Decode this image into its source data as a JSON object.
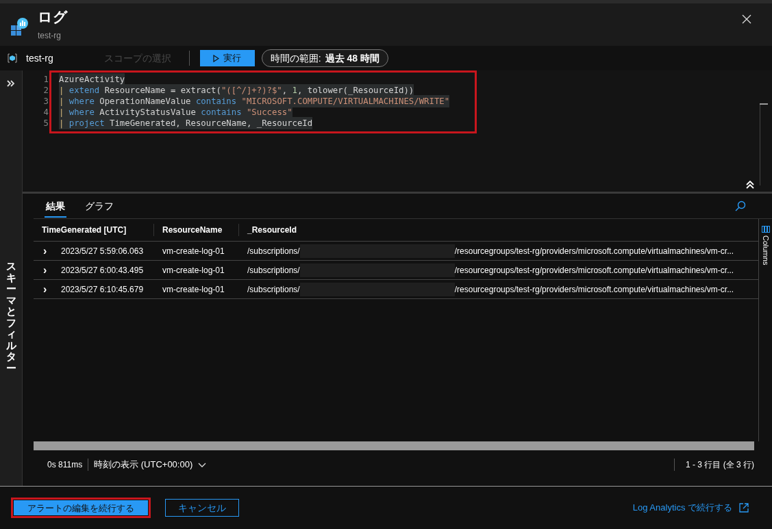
{
  "header": {
    "title": "ログ",
    "subtitle": "test-rg"
  },
  "toolbar": {
    "scope": "test-rg",
    "scope_select": {
      "label": "スコープの選択",
      "disabled": true
    },
    "run_button": "実行",
    "time_range": {
      "label": "時間の範囲:",
      "value": "過去 48 時間"
    }
  },
  "sidebar": {
    "label": "スキーマとフィルター"
  },
  "editor": {
    "lines": [
      {
        "number": "1",
        "tokens": [
          {
            "kind": "plain",
            "text": "AzureActivity"
          }
        ]
      },
      {
        "number": "2",
        "tokens": [
          {
            "kind": "pipe",
            "text": "| "
          },
          {
            "kind": "keyword",
            "text": "extend"
          },
          {
            "kind": "plain",
            "text": " ResourceName = extract("
          },
          {
            "kind": "string",
            "text": "\"([^/]+?)?$\""
          },
          {
            "kind": "plain",
            "text": ", "
          },
          {
            "kind": "number",
            "text": "1"
          },
          {
            "kind": "plain",
            "text": ", tolower(_ResourceId))"
          }
        ]
      },
      {
        "number": "3",
        "tokens": [
          {
            "kind": "pipe",
            "text": "| "
          },
          {
            "kind": "keyword",
            "text": "where"
          },
          {
            "kind": "plain",
            "text": " OperationNameValue "
          },
          {
            "kind": "keyword",
            "text": "contains"
          },
          {
            "kind": "string",
            "text": " \"MICROSOFT.COMPUTE/VIRTUALMACHINES/WRITE\""
          }
        ]
      },
      {
        "number": "4",
        "tokens": [
          {
            "kind": "pipe",
            "text": "| "
          },
          {
            "kind": "keyword",
            "text": "where"
          },
          {
            "kind": "plain",
            "text": " ActivityStatusValue "
          },
          {
            "kind": "keyword",
            "text": "contains"
          },
          {
            "kind": "string",
            "text": " \"Success\""
          }
        ]
      },
      {
        "number": "5",
        "tokens": [
          {
            "kind": "pipe",
            "text": "| "
          },
          {
            "kind": "keyword",
            "text": "project"
          },
          {
            "kind": "plain",
            "text": " TimeGenerated, ResourceName, _ResourceId"
          }
        ]
      }
    ]
  },
  "results": {
    "tabs": [
      {
        "label": "結果",
        "selected": true
      },
      {
        "label": "グラフ",
        "selected": false
      }
    ],
    "table": {
      "columns": [
        "TimeGenerated [UTC]",
        "ResourceName",
        "_ResourceId"
      ],
      "rows": [
        {
          "expander": "›",
          "time": "2023/5/27 5:59:06.063",
          "resource_name": "vm-create-log-01",
          "resource_id_start": "/subscriptions/",
          "resource_id_end": "/resourcegroups/test-rg/providers/microsoft.compute/virtualmachines/vm-cr..."
        },
        {
          "expander": "›",
          "time": "2023/5/27 6:00:43.495",
          "resource_name": "vm-create-log-01",
          "resource_id_start": "/subscriptions/",
          "resource_id_end": "/resourcegroups/test-rg/providers/microsoft.compute/virtualmachines/vm-cr..."
        },
        {
          "expander": "›",
          "time": "2023/5/27 6:10:45.679",
          "resource_name": "vm-create-log-01",
          "resource_id_start": "/subscriptions/",
          "resource_id_end": "/resourcegroups/test-rg/providers/microsoft.compute/virtualmachines/vm-cr..."
        }
      ]
    },
    "columns_panel": "Columns",
    "footer": {
      "duration": "0s 811ms",
      "time_display": "時刻の表示 (UTC+00:00)",
      "row_count": "1 - 3 行目 (全 3 行)"
    }
  },
  "actions": {
    "continue_button": "アラートの編集を続行する",
    "cancel_button": "キャンセル",
    "log_analytics_link": "Log Analytics で続行する"
  }
}
